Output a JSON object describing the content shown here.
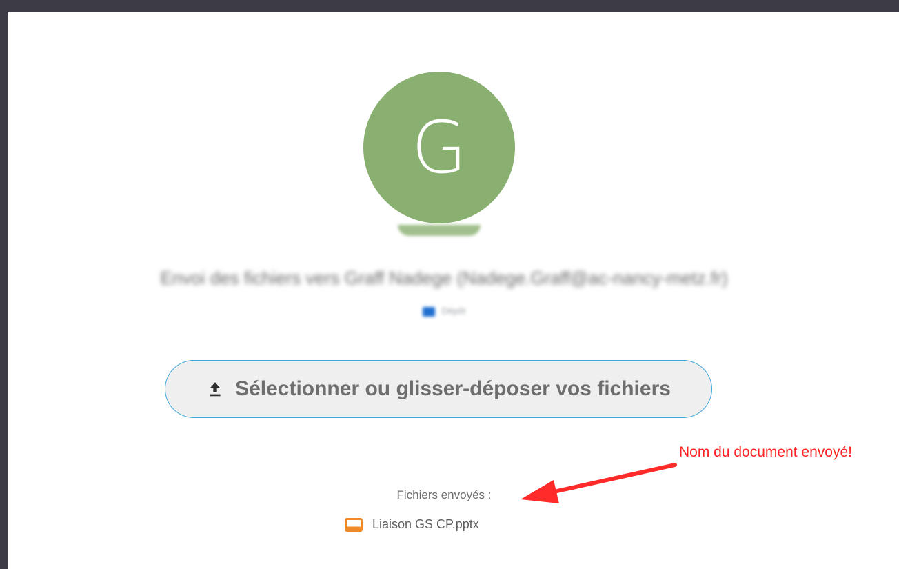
{
  "avatar": {
    "initial": "G",
    "color": "#89b070"
  },
  "header": {
    "recipient_line": "Envoi des fichiers vers Graff Nadege (Nadege.Graff@ac-nancy-metz.fr)",
    "folder_label": "Dépôt"
  },
  "upload": {
    "label": "Sélectionner ou glisser-déposer vos fichiers",
    "icon": "upload-icon",
    "border_color": "#3ba7d9"
  },
  "annotation": {
    "text": "Nom du document envoyé!",
    "color": "#ff2222"
  },
  "sent_files": {
    "title": "Fichiers envoyés :",
    "files": [
      {
        "name": "Liaison GS CP.pptx",
        "icon": "presentation-file-icon",
        "icon_color": "#f08a24"
      }
    ]
  }
}
